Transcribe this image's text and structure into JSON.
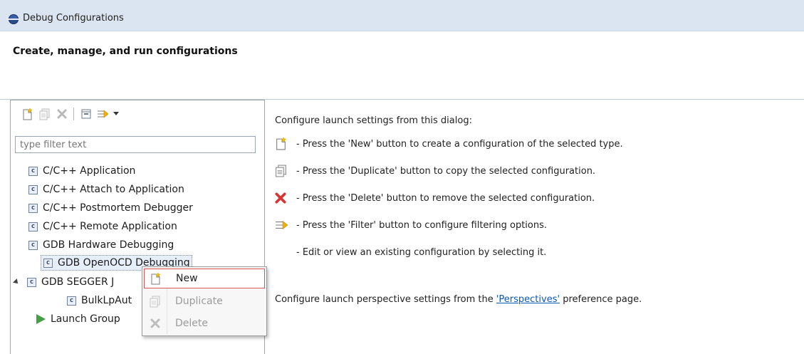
{
  "window": {
    "title": "Debug Configurations",
    "heading": "Create, manage, and run configurations"
  },
  "filter": {
    "placeholder": "type filter text",
    "value": ""
  },
  "tree": [
    {
      "label": "C/C++ Application",
      "icon": "c-config-icon"
    },
    {
      "label": "C/C++ Attach to Application",
      "icon": "c-config-icon"
    },
    {
      "label": "C/C++ Postmortem Debugger",
      "icon": "c-config-icon"
    },
    {
      "label": "C/C++ Remote Application",
      "icon": "c-config-icon"
    },
    {
      "label": "GDB Hardware Debugging",
      "icon": "c-config-icon"
    },
    {
      "label": "GDB OpenOCD Debugging",
      "icon": "c-config-icon",
      "selected": true
    },
    {
      "label": "GDB SEGGER J",
      "icon": "c-config-icon",
      "expanded": true
    },
    {
      "label": "BulkLpAut",
      "icon": "c-config-icon"
    },
    {
      "label": "Launch Group",
      "icon": "launch-group-icon"
    }
  ],
  "right_panel": {
    "intro": "Configure launch settings from this dialog:",
    "tips": [
      {
        "icon": "new-config-icon",
        "text": "- Press the 'New' button to create a configuration of the selected type."
      },
      {
        "icon": "duplicate-icon",
        "text": "- Press the 'Duplicate' button to copy the selected configuration."
      },
      {
        "icon": "delete-icon",
        "text": "- Press the 'Delete' button to remove the selected configuration."
      },
      {
        "icon": "filter-icon",
        "text": "- Press the 'Filter' button to configure filtering options."
      },
      {
        "icon": "",
        "text": "- Edit or view an existing configuration by selecting it."
      }
    ],
    "perspective_prefix": "Configure launch perspective settings from the ",
    "perspective_link": "'Perspectives'",
    "perspective_suffix": " preference page."
  },
  "context_menu": {
    "items": [
      {
        "label": "New",
        "enabled": true,
        "hover": true
      },
      {
        "label": "Duplicate",
        "enabled": false
      },
      {
        "label": "Delete",
        "enabled": false
      }
    ]
  },
  "colors": {
    "titlebar_bg": "#dbe5f1",
    "link": "#0b59b6",
    "menu_hover_border": "#d9534f",
    "delete_red": "#d93434",
    "launch_green": "#43a047"
  }
}
